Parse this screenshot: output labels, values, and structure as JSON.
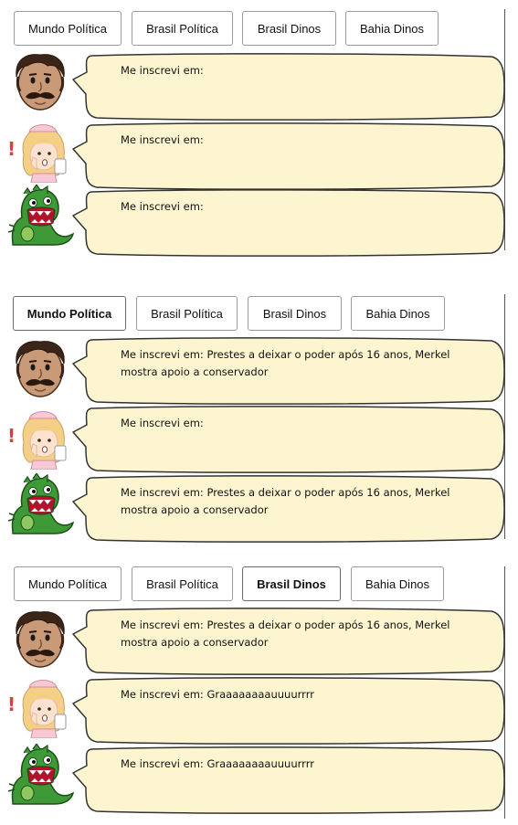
{
  "tabs": [
    "Mundo Política",
    "Brasil Política",
    "Brasil Dinos",
    "Bahia Dinos"
  ],
  "icons": {
    "man": "man-with-mustache-icon",
    "nurse": "nurse-icon",
    "dino": "green-dinosaur-icon"
  },
  "colors": {
    "bubble_fill": "#fdf5d0",
    "bubble_stroke": "#333333",
    "dino_green": "#3e9a37",
    "nurse_hair": "#f4cf85"
  },
  "panels": [
    {
      "active_tab": null,
      "messages": [
        {
          "avatar": "man",
          "text": "Me inscrevi em:"
        },
        {
          "avatar": "nurse",
          "text": "Me inscrevi em:"
        },
        {
          "avatar": "dino",
          "text": "Me inscrevi em:"
        }
      ]
    },
    {
      "active_tab": "Mundo Política",
      "messages": [
        {
          "avatar": "man",
          "text": "Me inscrevi em: Prestes a deixar o poder após 16 anos, Merkel mostra apoio a conservador"
        },
        {
          "avatar": "nurse",
          "text": "Me inscrevi em:"
        },
        {
          "avatar": "dino",
          "text": "Me inscrevi em: Prestes a deixar o poder após 16 anos, Merkel mostra apoio a conservador"
        }
      ]
    },
    {
      "active_tab": "Brasil Dinos",
      "messages": [
        {
          "avatar": "man",
          "text": "Me inscrevi em: Prestes a deixar o poder após 16 anos, Merkel mostra apoio a conservador"
        },
        {
          "avatar": "nurse",
          "text": "Me inscrevi em: Graaaaaaaauuuurrrr"
        },
        {
          "avatar": "dino",
          "text": "Me inscrevi em: Graaaaaaaauuuurrrr"
        }
      ]
    }
  ]
}
